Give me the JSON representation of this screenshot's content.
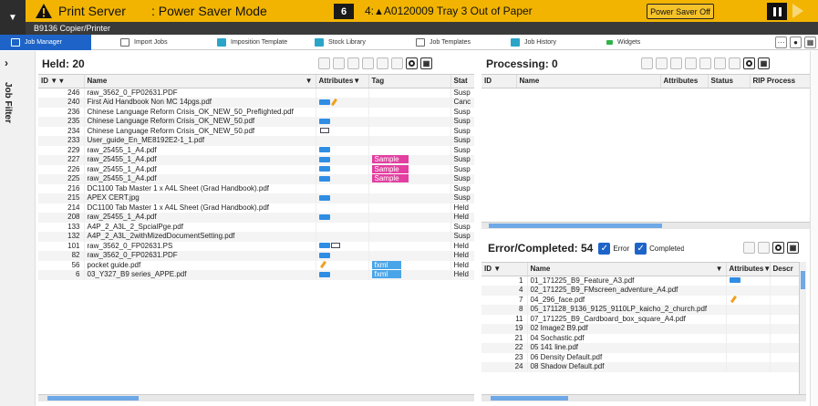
{
  "banner": {
    "title": "Print Server",
    "mode": ": Power Saver Mode",
    "count": "6",
    "alert_prefix": "4:",
    "alert_rest": "A0120009 Tray 3 Out of Paper",
    "power_saver_btn": "Power Saver Off",
    "subtitle": "B9136 Copier/Printer",
    "color": "#f2b400"
  },
  "tabs": [
    {
      "label": "Job Manager",
      "icon": "job-manager-icon"
    },
    {
      "label": "Import Jobs",
      "icon": "import-icon"
    },
    {
      "label": "Imposition Template",
      "icon": "imposition-icon"
    },
    {
      "label": "Stock Library",
      "icon": "stock-icon"
    },
    {
      "label": "Job Templates",
      "icon": "template-icon"
    },
    {
      "label": "Job History",
      "icon": "history-icon"
    },
    {
      "label": "Widgets",
      "icon": "widgets-icon"
    }
  ],
  "side": {
    "label": "Job Filter"
  },
  "held": {
    "title": "Held: 20",
    "columns": [
      "ID",
      "Name",
      "Attributes",
      "Tag",
      "Stat"
    ],
    "rows": [
      {
        "id": "246",
        "name": "raw_3562_0_FP02631.PDF",
        "attrs": "",
        "tag": "",
        "status": "Susp"
      },
      {
        "id": "240",
        "name": "First Aid Handbook Non MC 14pgs.pdf",
        "attrs": "rip,pen",
        "tag": "",
        "status": "Canc"
      },
      {
        "id": "236",
        "name": "Chinese Language Reform Crisis_OK_NEW_50_Preflighted.pdf",
        "attrs": "",
        "tag": "",
        "status": "Susp"
      },
      {
        "id": "235",
        "name": "Chinese Language Reform Crisis_OK_NEW_50.pdf",
        "attrs": "rip",
        "tag": "",
        "status": "Susp"
      },
      {
        "id": "234",
        "name": "Chinese Language Reform Crisis_OK_NEW_50.pdf",
        "attrs": "cam",
        "tag": "",
        "status": "Susp"
      },
      {
        "id": "233",
        "name": "User_guide_En_ME8192E2-1_1.pdf",
        "attrs": "",
        "tag": "",
        "status": "Susp"
      },
      {
        "id": "229",
        "name": "raw_25455_1_A4.pdf",
        "attrs": "rip",
        "tag": "",
        "status": "Susp"
      },
      {
        "id": "227",
        "name": "raw_25455_1_A4.pdf",
        "attrs": "rip",
        "tag": "Sample",
        "status": "Susp"
      },
      {
        "id": "226",
        "name": "raw_25455_1_A4.pdf",
        "attrs": "rip",
        "tag": "Sample",
        "status": "Susp"
      },
      {
        "id": "225",
        "name": "raw_25455_1_A4.pdf",
        "attrs": "rip",
        "tag": "Sample",
        "status": "Susp"
      },
      {
        "id": "216",
        "name": "DC1100 Tab Master 1 x A4L Sheet (Grad Handbook).pdf",
        "attrs": "",
        "tag": "",
        "status": "Susp"
      },
      {
        "id": "215",
        "name": "APEX CERT.jpg",
        "attrs": "rip",
        "tag": "",
        "status": "Susp"
      },
      {
        "id": "214",
        "name": "DC1100 Tab Master 1 x A4L Sheet (Grad Handbook).pdf",
        "attrs": "",
        "tag": "",
        "status": "Held"
      },
      {
        "id": "208",
        "name": "raw_25455_1_A4.pdf",
        "attrs": "rip",
        "tag": "",
        "status": "Held"
      },
      {
        "id": "133",
        "name": "A4P_2_A3L_2_SpcialPge.pdf",
        "attrs": "",
        "tag": "",
        "status": "Susp"
      },
      {
        "id": "132",
        "name": "A4P_2_A3L_2withMizedDocumentSetting.pdf",
        "attrs": "",
        "tag": "",
        "status": "Susp"
      },
      {
        "id": "101",
        "name": "raw_3562_0_FP02631.PS",
        "attrs": "rip,cam",
        "tag": "",
        "status": "Held"
      },
      {
        "id": "82",
        "name": "raw_3562_0_FP02631.PDF",
        "attrs": "rip",
        "tag": "",
        "status": "Held"
      },
      {
        "id": "56",
        "name": "pocket guide.pdf",
        "attrs": "pen",
        "tag": "fxml",
        "status": "Held"
      },
      {
        "id": "6",
        "name": "03_Y327_B9 series_APPE.pdf",
        "attrs": "rip",
        "tag": "fxml",
        "status": "Held"
      }
    ]
  },
  "processing": {
    "title": "Processing: 0",
    "columns": [
      "ID",
      "Name",
      "Attributes",
      "Status",
      "RIP Process"
    ]
  },
  "completed": {
    "title": "Error/Completed: 54",
    "error_label": "Error",
    "completed_label": "Completed",
    "columns": [
      "ID",
      "Name",
      "Attributes",
      "Descr"
    ],
    "rows": [
      {
        "id": "1",
        "name": "01_171225_B9_Feature_A3.pdf",
        "attrs": "rip"
      },
      {
        "id": "4",
        "name": "02_171225_B9_FMscreen_adventure_A4.pdf",
        "attrs": ""
      },
      {
        "id": "7",
        "name": "04_296_face.pdf",
        "attrs": "pen"
      },
      {
        "id": "8",
        "name": "05_171128_9136_9125_9110LP_kaicho_2_church.pdf",
        "attrs": ""
      },
      {
        "id": "11",
        "name": "07_171225_B9_Cardboard_box_square_A4.pdf",
        "attrs": ""
      },
      {
        "id": "19",
        "name": "02 Image2 B9.pdf",
        "attrs": ""
      },
      {
        "id": "21",
        "name": "04 Sochastic.pdf",
        "attrs": ""
      },
      {
        "id": "22",
        "name": "05 141 line.pdf",
        "attrs": ""
      },
      {
        "id": "23",
        "name": "06 Density Default.pdf",
        "attrs": ""
      },
      {
        "id": "24",
        "name": "08 Shadow Default.pdf",
        "attrs": ""
      }
    ]
  }
}
